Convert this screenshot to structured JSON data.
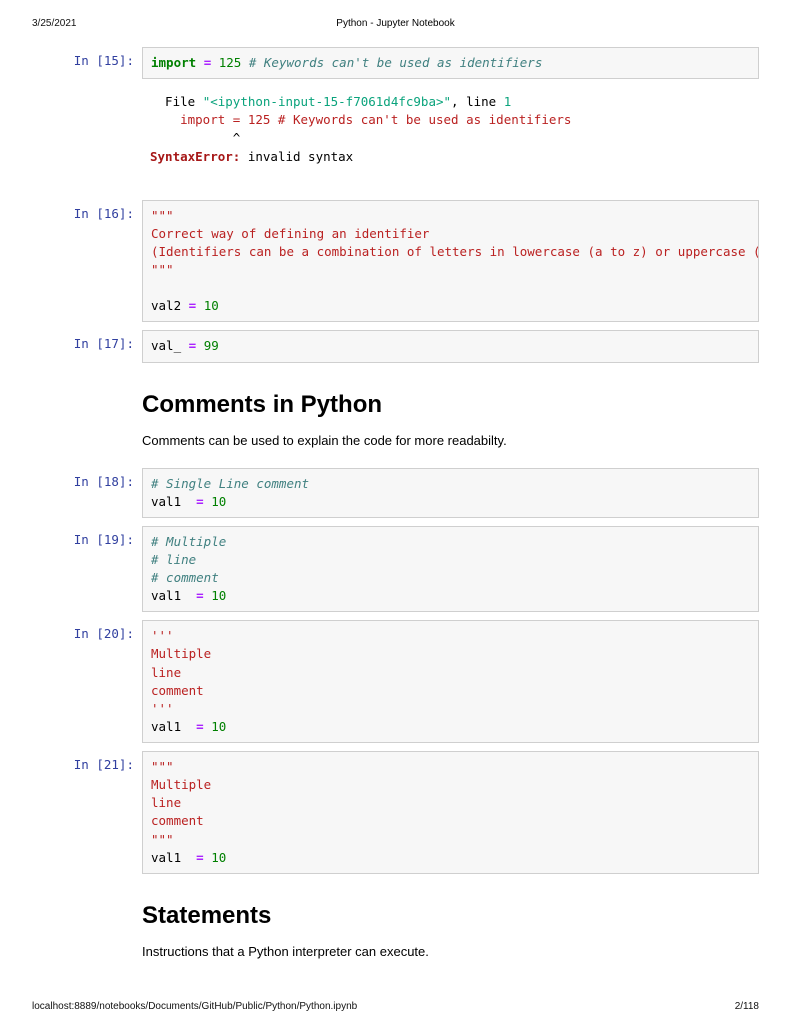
{
  "header": {
    "date": "3/25/2021",
    "title": "Python - Jupyter Notebook"
  },
  "footer": {
    "path": "localhost:8889/notebooks/Documents/GitHub/Public/Python/Python.ipynb",
    "page": "2/118"
  },
  "cells": {
    "c15": {
      "prompt": "In [15]:",
      "code": {
        "kw": "import",
        "op": "=",
        "num": "125",
        "cmt": "# Keywords can't be used as identifiers"
      },
      "out": {
        "file_label": "  File ",
        "file_name": "\"<ipython-input-15-f7061d4fc9ba>\"",
        "line_label": ", line ",
        "line_no": "1",
        "echo": "    import = 125 # Keywords can't be used as identifiers",
        "caret": "           ^",
        "err_name": "SyntaxError:",
        "err_msg": " invalid syntax"
      }
    },
    "c16": {
      "prompt": "In [16]:",
      "tq1": "\"\"\"",
      "line1": "Correct way of defining an identifier",
      "line2": "(Identifiers can be a combination of letters in lowercase (a to z) or uppercase (",
      "tq2": "\"\"\"",
      "blank": "",
      "var": "val2 ",
      "op": "=",
      "sp": " ",
      "num": "10"
    },
    "c17": {
      "prompt": "In [17]:",
      "var": "val_ ",
      "op": "=",
      "sp": " ",
      "num": "99"
    },
    "md1": {
      "h": "Comments in Python",
      "p": "Comments can be used to explain the code for more readabilty."
    },
    "c18": {
      "prompt": "In [18]:",
      "cmt": "# Single Line comment",
      "var": "val1  ",
      "op": "=",
      "sp": " ",
      "num": "10"
    },
    "c19": {
      "prompt": "In [19]:",
      "cmt1": "# Multiple",
      "cmt2": "# line",
      "cmt3": "# comment",
      "var": "val1  ",
      "op": "=",
      "sp": " ",
      "num": "10"
    },
    "c20": {
      "prompt": "In [20]:",
      "tq1": "'''",
      "l1": "Multiple",
      "l2": "line",
      "l3": "comment",
      "tq2": "'''",
      "var": "val1  ",
      "op": "=",
      "sp": " ",
      "num": "10"
    },
    "c21": {
      "prompt": "In [21]:",
      "tq1": "\"\"\"",
      "l1": "Multiple",
      "l2": "line",
      "l3": "comment",
      "tq2": "\"\"\"",
      "var": "val1  ",
      "op": "=",
      "sp": " ",
      "num": "10"
    },
    "md2": {
      "h": "Statements",
      "p": "Instructions that a Python interpreter can execute."
    }
  }
}
